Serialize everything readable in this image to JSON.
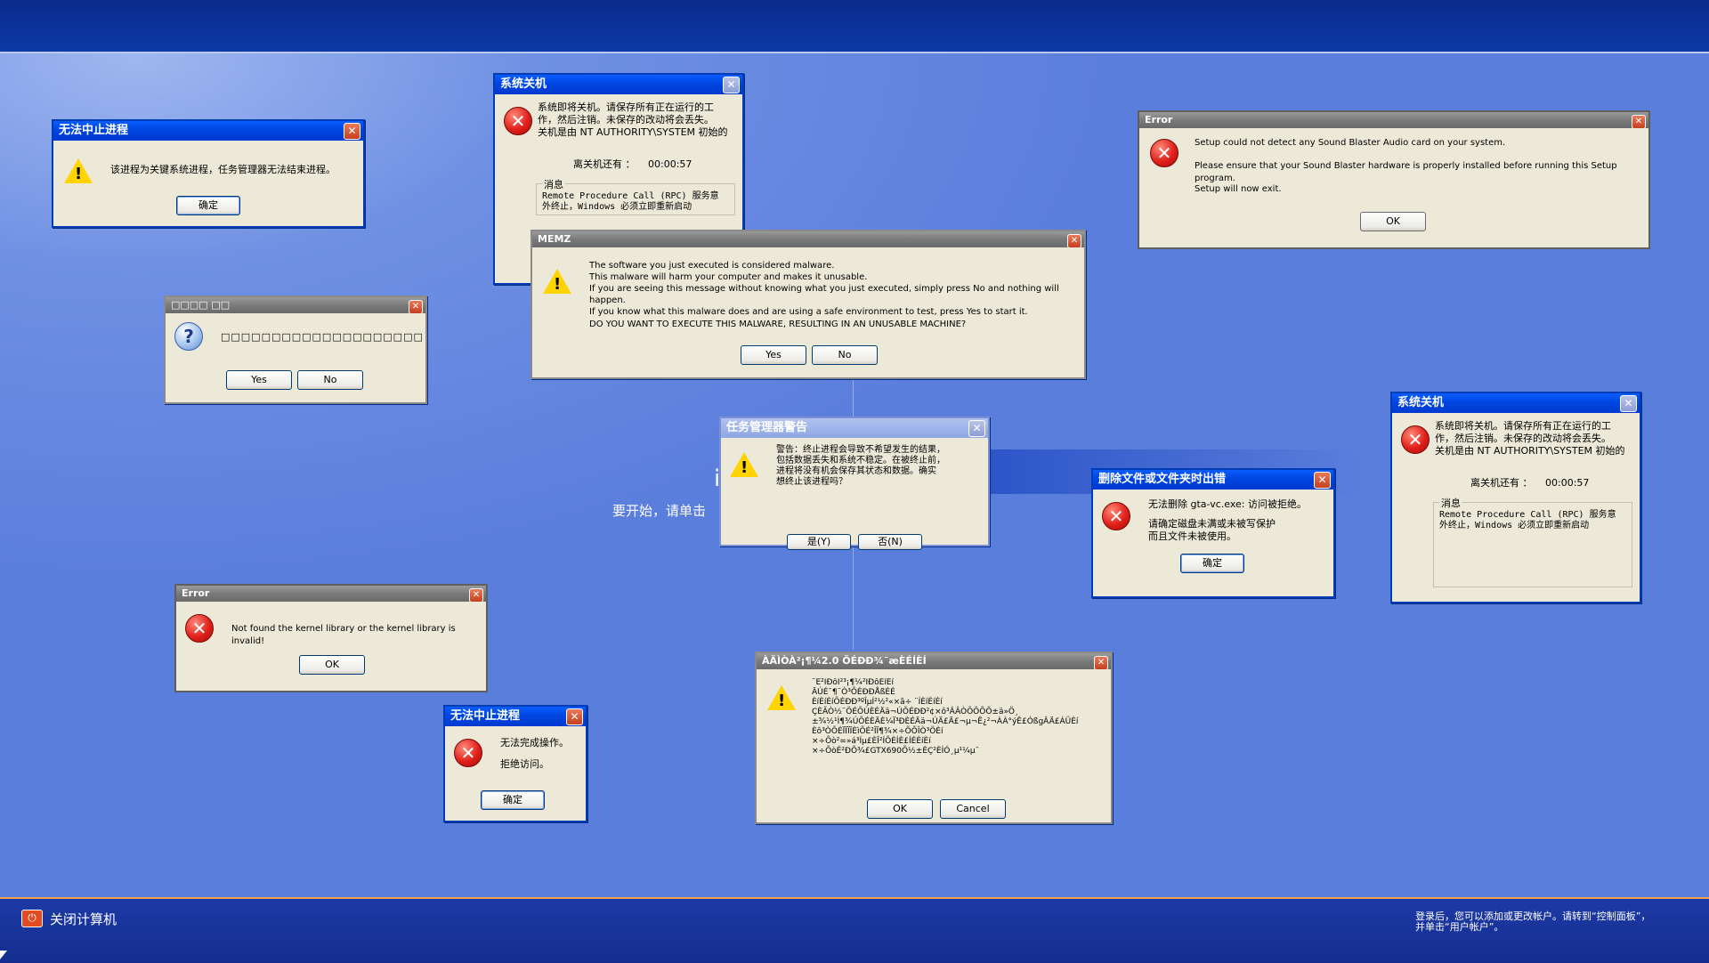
{
  "screen": {
    "welcome_partial": "i",
    "start_partial": "要开始，请单击"
  },
  "bottom": {
    "shutdown_label": "关闭计算机",
    "hint_text": "登录后，您可以添加或更改帐户。请转到“控制面板”，\n并单击“用户帐户”。"
  },
  "dialogs": {
    "d1": {
      "title": "无法中止进程",
      "message": "该进程为关键系统进程，任务管理器无法结束进程。",
      "ok": "确定"
    },
    "d2": {
      "title": "系统关机",
      "message": "系统即将关机。请保存所有正在运行的工\n作，然后注销。未保存的改动将会丢失。\n关机是由 NT AUTHORITY\\SYSTEM 初始的",
      "countdown_label": "离关机还有 ：",
      "countdown": "00:00:57",
      "group_label": "消息",
      "group_text": "Remote Procedure Call (RPC) 服务意\n外终止，Windows 必须立即重新启动"
    },
    "d3": {
      "title": "Error",
      "line1": "Setup could not detect any Sound Blaster Audio card on your system.",
      "line2": "Please ensure that your Sound Blaster hardware is properly installed before running this Setup program.",
      "line3": "Setup will now exit.",
      "ok": "OK"
    },
    "d4": {
      "title": "□□□□ □□",
      "message": "□□□□□□□□□□□□□□□□□□□□",
      "yes": "Yes",
      "no": "No"
    },
    "d5": {
      "title": "MEMZ",
      "message": "The software you just executed is considered malware.\nThis malware will harm your computer and makes it unusable.\nIf you are seeing this message without knowing what you just executed, simply press No and nothing will happen.\nIf you know what this malware does and are using a safe environment to test, press Yes to start it.",
      "question": "DO YOU WANT TO EXECUTE THIS MALWARE, RESULTING IN AN UNUSABLE MACHINE?",
      "yes": "Yes",
      "no": "No"
    },
    "d6": {
      "title": "任务管理器警告",
      "message": "警告：终止进程会导致不希望发生的结果，\n包括数据丢失和系统不稳定。在被终止前，\n进程将没有机会保存其状态和数据。确实\n想终止该进程吗？",
      "yes": "是(Y)",
      "no": "否(N)"
    },
    "d7": {
      "title": "系统关机",
      "message": "系统即将关机。请保存所有正在运行的工\n作，然后注销。未保存的改动将会丢失。\n关机是由 NT AUTHORITY\\SYSTEM 初始的",
      "countdown_label": "离关机还有 ：",
      "countdown": "00:00:57",
      "group_label": "消息",
      "group_text": "Remote Procedure Call (RPC) 服务意\n外终止，Windows 必须立即重新启动"
    },
    "d8": {
      "title": "删除文件或文件夹时出错",
      "message": "无法删除 gta-vc.exe: 访问被拒绝。",
      "detail": "请确定磁盘未满或未被写保护\n而且文件未被使用。",
      "ok": "确定"
    },
    "d9": {
      "title": "Error",
      "message": "Not found the kernel library or the kernel library is invalid!",
      "ok": "OK"
    },
    "d10": {
      "title": "无法中止进程",
      "line1": "无法完成操作。",
      "line2": "拒绝访问。",
      "ok": "确定"
    },
    "d11": {
      "title": "ÀÄÌÒÀ²¡¶¼2.0 ÕÉÐÐ¾¯æÈÉÍÈÍ",
      "message": "¨É²ÍÐôÎ²³¡¶¼²ÍÐôÉíÈí\nÄÚÉ¯¶¨Ò³ÕÉÐÐÅßÈÉ\nÈíÈíÈíÕÉÐÐ³ºÎµÍ²½²«×ã÷ ¨ÍÈíÈíÈí\nÇÈÃÒ½¨ÖÉÕÚÈÉÄä¬ÚÕÉÐÐ²¢×ô³ÂÂÒÕÕÕÕ±ä»Ö¸\n±¾½¹Ì¶¾ÚÕÉÈÄÈ¼Ï³ÐÈÉÄä¬ÚÄ£Ä£¬µ¬Ê¿²¬ÀÀ°ýÊ£ÓßgÂÄ£ÁÜÈí\nÈô³ÒÕÉÏÏÏÏÈìÕÉ²ÎÏ¶¾×÷ÕÕÎÒ³ÖÈí\n×÷Õò²=»á³Íµ£ÈÎ²ÍÕÈÍÈ£ÍÉÈíÈí\n×÷ÕòÉ²ÐÕ¾£GTX690Õ½±ÈÇ²ÈÍÓ¸µ¹¼µ¯",
      "ok": "OK",
      "cancel": "Cancel"
    }
  },
  "colors": {
    "xp_titlebar": "#0046e0",
    "dialog_face": "#ece9d8",
    "desktop": "#5a7edc",
    "close_button": "#c4401f"
  }
}
